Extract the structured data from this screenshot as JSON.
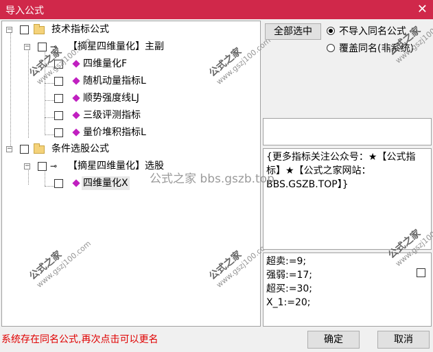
{
  "window": {
    "title": "导入公式",
    "close_glyph": "✕"
  },
  "tree": {
    "groups": [
      {
        "label": "技术指标公式"
      },
      {
        "label": "条件选股公式"
      }
    ],
    "files": [
      {
        "label": "【摘星四维量化】主副"
      },
      {
        "label": "【摘星四维量化】选股"
      }
    ],
    "items": [
      {
        "label": "四维量化F"
      },
      {
        "label": "随机动量指标L"
      },
      {
        "label": "顺势强度线LJ"
      },
      {
        "label": "三级评测指标"
      },
      {
        "label": "量价堆积指标L"
      },
      {
        "label": "四维量化X"
      }
    ],
    "expander_glyph": "−"
  },
  "controls": {
    "select_all_label": "全部选中",
    "radio_options": [
      {
        "label": "不导入同名公式",
        "selected": true
      },
      {
        "label": "覆盖同名(非系统)",
        "selected": false
      }
    ]
  },
  "description": "{更多指标关注公众号：★【公式指标】★【公式之家网站：BBS.GSZB.TOP】}",
  "params": [
    "超卖:=9;",
    "强弱:=17;",
    "超买:=30;",
    "X_1:=20;"
  ],
  "status_message": "系统存在同名公式,再次点击可以更名",
  "buttons": {
    "ok": "确定",
    "cancel": "取消"
  },
  "watermark": {
    "name": "公式之家",
    "url": "www.gszj100.com",
    "center_text": "公式之家 bbs.gszb.top"
  },
  "colors": {
    "titlebar": "#d0284a",
    "status_text": "#e00000",
    "item_icon": "#c020c0"
  }
}
